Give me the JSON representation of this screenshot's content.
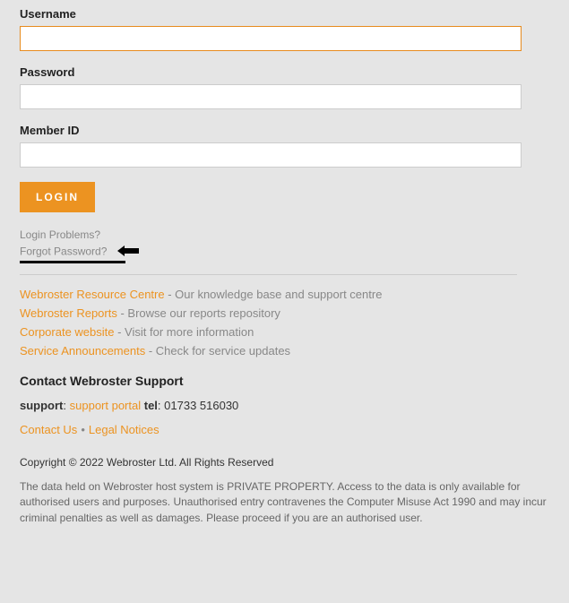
{
  "form": {
    "username_label": "Username",
    "username_value": "",
    "password_label": "Password",
    "password_value": "",
    "memberid_label": "Member ID",
    "memberid_value": "",
    "login_button": "LOGIN"
  },
  "help": {
    "login_problems": "Login Problems?",
    "forgot_password": "Forgot Password?"
  },
  "resources": {
    "resource_centre": "Webroster Resource Centre",
    "resource_centre_desc": " - Our knowledge base and support centre",
    "reports": "Webroster Reports",
    "reports_desc": " - Browse our reports repository",
    "corporate": "Corporate website",
    "corporate_desc": " - Visit for more information",
    "announcements": "Service Announcements",
    "announcements_desc": " - Check for service updates"
  },
  "support": {
    "heading": "Contact Webroster Support",
    "support_bold": "support",
    "support_colon": ": ",
    "support_portal": "support portal",
    "tel_bold": "tel",
    "tel_value": ": 01733 516030",
    "contact_us": "Contact Us",
    "legal": "Legal Notices"
  },
  "footer": {
    "copyright": "Copyright © 2022 Webroster Ltd. All Rights Reserved",
    "disclaimer": "The data held on Webroster host system is PRIVATE PROPERTY. Access to the data is only available for authorised users and purposes. Unauthorised entry contravenes the Computer Misuse Act 1990 and may incur criminal penalties as well as damages. Please proceed if you are an authorised user."
  }
}
